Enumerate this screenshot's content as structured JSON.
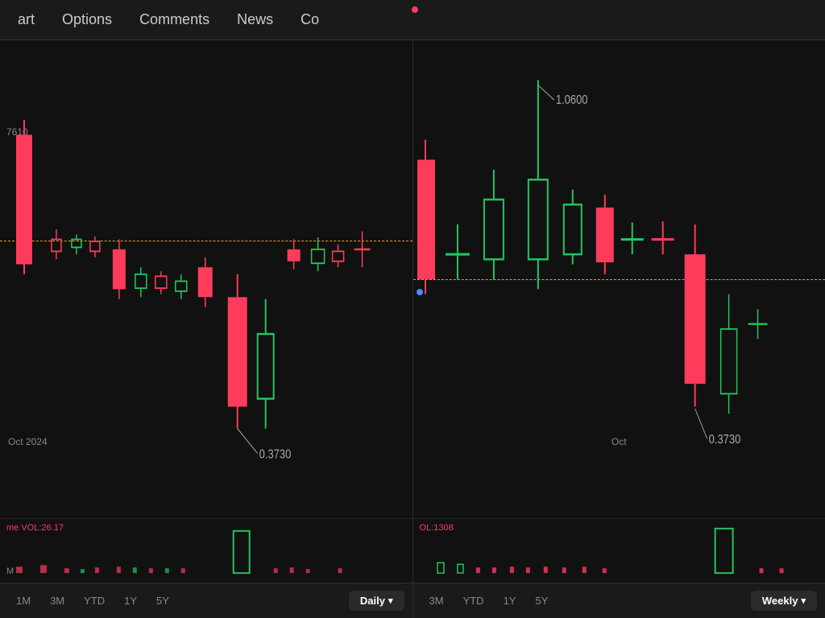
{
  "nav": {
    "items": [
      "art",
      "Options",
      "Comments",
      "News",
      "Co"
    ],
    "active": "Chart",
    "dot_color": "#ff3b5c"
  },
  "left_chart": {
    "price_label": "7610",
    "annotation_value": "0.3730",
    "ref_line_top_pct": 42,
    "date_label": "Oct 2024",
    "volume_label": "me",
    "volume_value": "VOL:26.17",
    "volume_unit": "M",
    "time_buttons": [
      "1M",
      "3M",
      "YTD",
      "1Y",
      "5Y"
    ],
    "interval": "Daily"
  },
  "right_chart": {
    "price_label_high": "1.0600",
    "price_label_low": "0.3730",
    "ref_line_top_pct": 50,
    "date_label": "Oct",
    "volume_label": "OL:1308",
    "time_buttons": [
      "3M",
      "YTD",
      "1Y",
      "5Y"
    ],
    "interval": "Weekly"
  }
}
